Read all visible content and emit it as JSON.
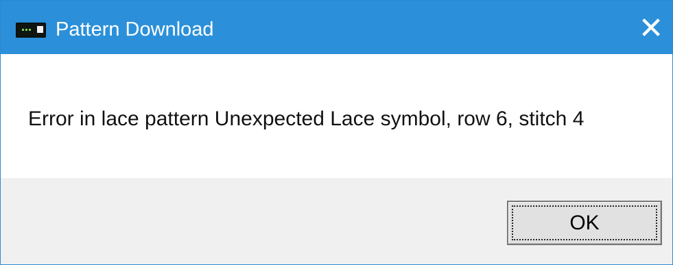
{
  "window": {
    "title": "Pattern Download",
    "icon": "machine-device-icon",
    "close_glyph": "✕"
  },
  "message": {
    "text": "Error in lace pattern Unexpected Lace symbol, row 6, stitch 4"
  },
  "buttons": {
    "ok_label": "OK"
  },
  "colors": {
    "titlebar": "#2b90d9",
    "footer": "#f0f0f0",
    "button": "#e1e1e1"
  }
}
